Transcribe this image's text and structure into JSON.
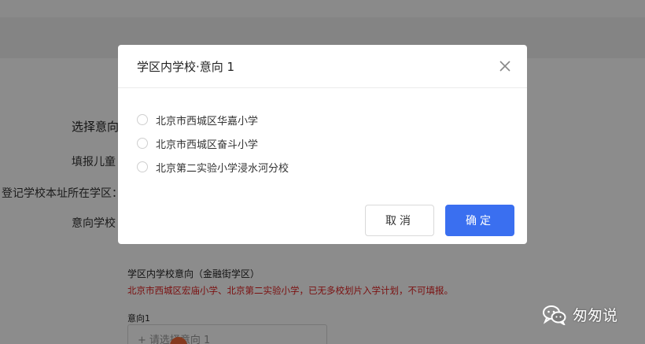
{
  "background": {
    "section_title": "选择意向",
    "label_child": "填报儿童",
    "label_district": "登记学校本址所在学区：",
    "label_intent": "意向学校",
    "intent_heading": "学区内学校意向（金融街学区）",
    "warning": "北京市西城区宏庙小学、北京第二实验小学，已无多校划片入学计划，不可填报。",
    "intent1_label": "意向1",
    "intent1_placeholder": "请选择意向 1",
    "plus_symbol": "+",
    "warning_color": "#e02020"
  },
  "modal": {
    "title": "学区内学校·意向 1",
    "close_icon": "close-icon",
    "options": [
      {
        "label": "北京市西城区华嘉小学",
        "selected": false
      },
      {
        "label": "北京市西城区奋斗小学",
        "selected": false
      },
      {
        "label": "北京第二实验小学浸水河分校",
        "selected": false
      }
    ],
    "cancel_label": "取消",
    "confirm_label": "确定",
    "accent_color": "#3a6ff0"
  },
  "watermark": {
    "text": "匆匆说",
    "icon": "wechat-icon"
  }
}
